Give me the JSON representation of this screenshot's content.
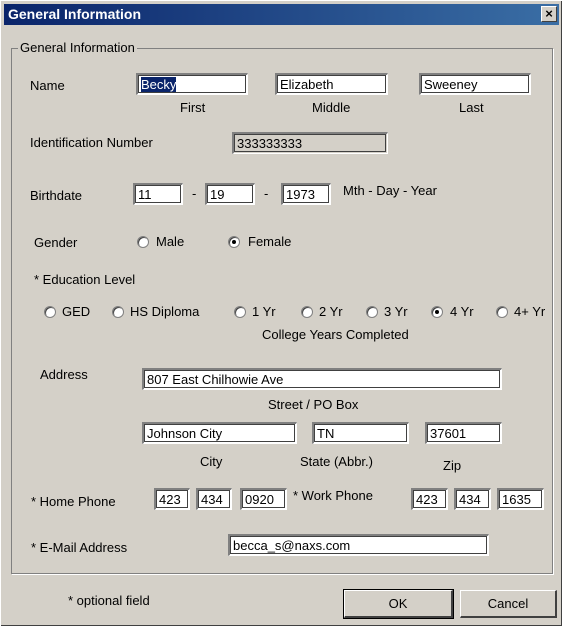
{
  "window": {
    "title": "General Information",
    "close_glyph": "×"
  },
  "group": {
    "legend": "General Information"
  },
  "name": {
    "label": "Name",
    "first": "Becky",
    "first_caption": "First",
    "middle": "Elizabeth",
    "middle_caption": "Middle",
    "last": "Sweeney",
    "last_caption": "Last"
  },
  "id": {
    "label": "Identification Number",
    "value": "333333333"
  },
  "birthdate": {
    "label": "Birthdate",
    "month": "11",
    "day": "19",
    "year": "1973",
    "sep": "-",
    "hint": "Mth - Day - Year"
  },
  "gender": {
    "label": "Gender",
    "options": [
      {
        "label": "Male",
        "selected": false
      },
      {
        "label": "Female",
        "selected": true
      }
    ]
  },
  "education": {
    "label": "* Education Level",
    "options": [
      {
        "label": "GED",
        "selected": false
      },
      {
        "label": "HS Diploma",
        "selected": false
      },
      {
        "label": "1 Yr",
        "selected": false
      },
      {
        "label": "2 Yr",
        "selected": false
      },
      {
        "label": "3 Yr",
        "selected": false
      },
      {
        "label": "4 Yr",
        "selected": true
      },
      {
        "label": "4+ Yr",
        "selected": false
      }
    ],
    "caption": "College Years Completed"
  },
  "address": {
    "label": "Address",
    "street": "807 East Chilhowie Ave",
    "street_caption": "Street / PO Box",
    "city": "Johnson City",
    "city_caption": "City",
    "state": "TN",
    "state_caption": "State (Abbr.)",
    "zip": "37601",
    "zip_caption": "Zip"
  },
  "home_phone": {
    "label": "* Home Phone",
    "area": "423",
    "prefix": "434",
    "line": "0920"
  },
  "work_phone": {
    "label": "* Work Phone",
    "area": "423",
    "prefix": "434",
    "line": "1635"
  },
  "email": {
    "label": "* E-Mail Address",
    "value": "becca_s@naxs.com"
  },
  "footer": {
    "note": "* optional field",
    "ok_label": "OK",
    "cancel_label": "Cancel"
  }
}
